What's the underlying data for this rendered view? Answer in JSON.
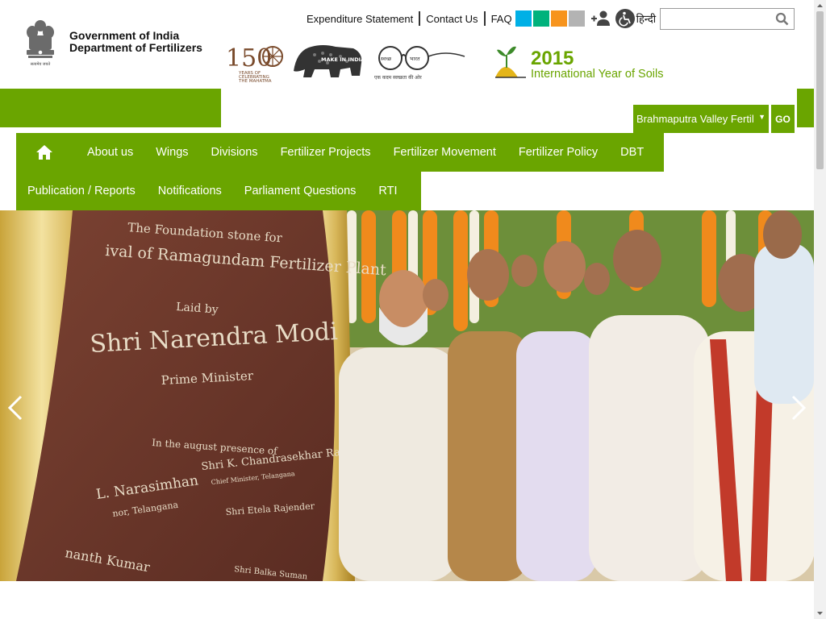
{
  "header": {
    "org_line1": "Government of India",
    "org_line2": "Department of Fertilizers",
    "emblem_caption": "सत्यमेव जयते"
  },
  "top_links": {
    "expenditure": "Expenditure Statement",
    "contact": "Contact Us",
    "faq": "FAQ",
    "hindi": "हिन्दी"
  },
  "theme_swatches": [
    "#00b0e6",
    "#00b27c",
    "#f7941d",
    "#b3b3b3"
  ],
  "logos": {
    "gandhi_number": "150",
    "gandhi_text1": "YEARS OF",
    "gandhi_text2": "CELEBRATING",
    "gandhi_text3": "THE MAHATMA",
    "make_in_india": "MAKE IN INDIA",
    "swachh1": "स्वच्छ",
    "swachh2": "भारत",
    "swachh_tag": "एक कदम स्वच्छता की ओर",
    "soils_year": "2015",
    "soils_text": "International Year of Soils"
  },
  "search": {
    "placeholder": "",
    "value": ""
  },
  "unit_select": {
    "selected": "Brahmaputra Valley Fertil",
    "go_label": "GO"
  },
  "nav": {
    "row1": [
      "About us",
      "Wings",
      "Divisions",
      "Fertilizer Projects",
      "Fertilizer Movement",
      "Fertilizer Policy",
      "DBT"
    ],
    "row2": [
      "Publication / Reports",
      "Notifications",
      "Parliament Questions",
      "RTI"
    ]
  },
  "banner": {
    "plaque_line1": "The Foundation stone for",
    "plaque_line2": "ival of Ramagundam Fertilizer Plant",
    "plaque_line3": "Laid by",
    "plaque_line4": "Shri Narendra Modi",
    "plaque_line5": "Prime Minister",
    "plaque_line6": "In the august presence of",
    "plaque_line7": "Shri K. Chandrasekhar Rao",
    "plaque_line8": "Chief Minister, Telangana",
    "plaque_line9": "L. Narasimhan",
    "plaque_line10": "nor, Telangana",
    "plaque_line11": "Shri Etela Rajender",
    "plaque_line12": "nanth Kumar",
    "plaque_line13": "Shri Balka Suman"
  },
  "colors": {
    "brand_green": "#6aa500",
    "plaque": "#6e3a2c"
  }
}
